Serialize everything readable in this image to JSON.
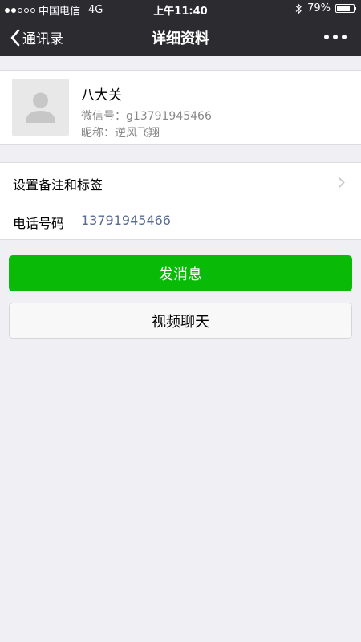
{
  "status": {
    "carrier": "中国电信",
    "network": "4G",
    "time": "上午11:40",
    "battery": "79%",
    "battery_level": 0.79,
    "signal_bars": 2
  },
  "nav": {
    "back_label": "通讯录",
    "title": "详细资料",
    "more_icon": "more-dots-icon"
  },
  "profile": {
    "name": "八大关",
    "wechat_id": "微信号：g13791945466",
    "nickname": "昵称：逆风飞翔",
    "avatar_icon": "default-avatar-icon"
  },
  "list": {
    "remark_label": "设置备注和标签",
    "phone_label": "电话号码",
    "phone_value": "13791945466"
  },
  "actions": {
    "message_label": "发消息",
    "video_label": "视频聊天"
  },
  "colors": {
    "nav_bg": "#2b2b30",
    "primary_green": "#09bb07",
    "link_blue": "#576b95",
    "page_bg": "#efeff4"
  }
}
